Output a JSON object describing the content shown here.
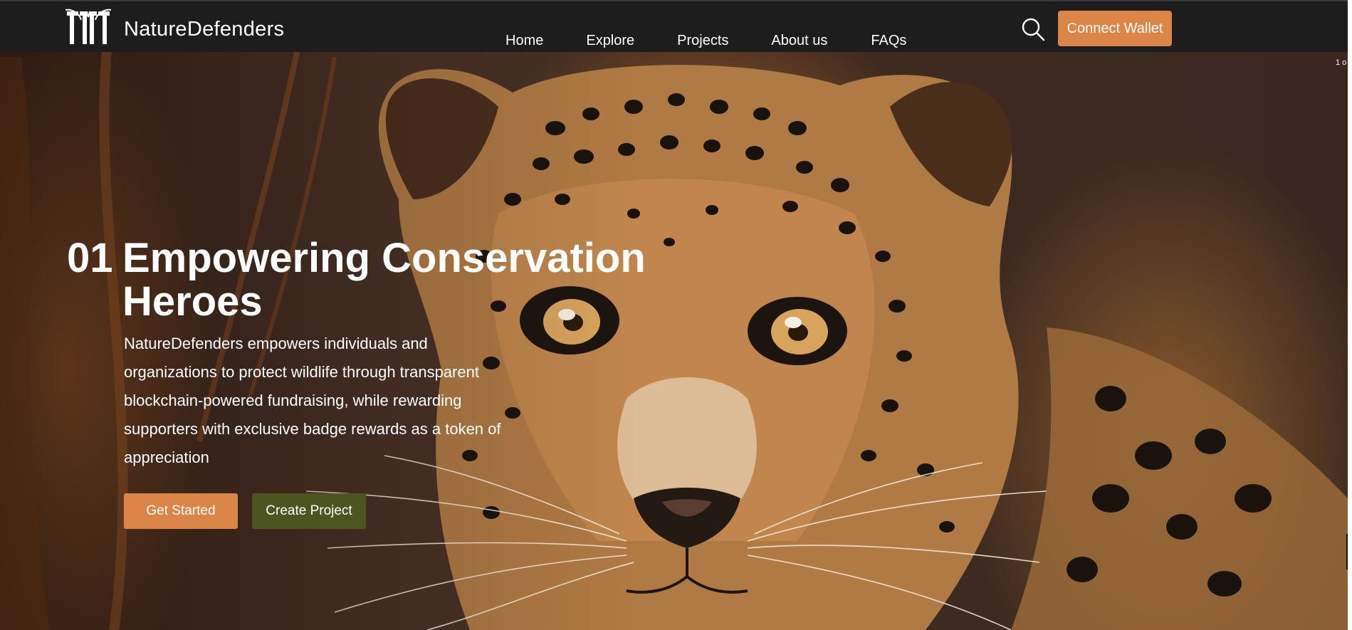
{
  "brand": {
    "name": "NatureDefenders"
  },
  "nav": {
    "items": [
      {
        "label": "Home"
      },
      {
        "label": "Explore"
      },
      {
        "label": "Projects"
      },
      {
        "label": "About us"
      },
      {
        "label": "FAQs"
      }
    ],
    "connect_wallet_label": "Connect Wallet",
    "search_icon": "search-icon"
  },
  "hero": {
    "slide_number": "01",
    "title_line1": "Empowering Conservation",
    "title_line2": "Heroes",
    "description": "NatureDefenders empowers individuals and organizations to protect wildlife through transparent blockchain-powered fundraising, while rewarding supporters with exclusive badge rewards as a token of appreciation",
    "primary_button": "Get Started",
    "secondary_button": "Create Project",
    "slide_counter": "1 o"
  },
  "colors": {
    "navbar_bg": "#1d1d1d",
    "accent_orange": "#dc8548",
    "accent_olive": "#4c5520",
    "text": "#ffffff"
  }
}
